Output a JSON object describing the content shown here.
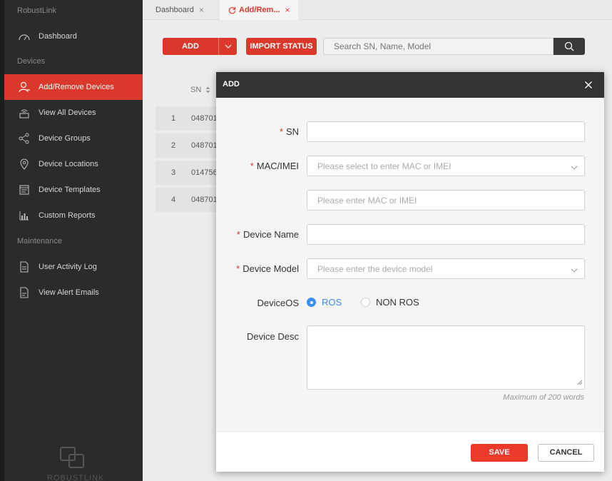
{
  "sidebar": {
    "brand": "RobustLink",
    "sections": {
      "devices": "Devices",
      "maintenance": "Maintenance"
    },
    "items": [
      {
        "label": "Dashboard",
        "icon": "gauge-icon"
      },
      {
        "label": "Add/Remove Devices",
        "icon": "user-add-icon",
        "active": true
      },
      {
        "label": "View All Devices",
        "icon": "router-icon"
      },
      {
        "label": "Device Groups",
        "icon": "share-nodes-icon"
      },
      {
        "label": "Device Locations",
        "icon": "location-pin-icon"
      },
      {
        "label": "Device Templates",
        "icon": "template-icon"
      },
      {
        "label": "Custom Reports",
        "icon": "bar-chart-icon"
      },
      {
        "label": "User Activity Log",
        "icon": "log-document-icon"
      },
      {
        "label": "View Alert Emails",
        "icon": "email-document-icon"
      }
    ],
    "footer_text": "ROBUSTLINK"
  },
  "tabs": [
    {
      "label": "Dashboard",
      "close": "×"
    },
    {
      "label": "Add/Rem...",
      "close": "×",
      "active": true
    }
  ],
  "toolbar": {
    "add_label": "ADD",
    "import_label": "IMPORT STATUS",
    "search_placeholder": "Search SN, Name, Model"
  },
  "table": {
    "sn_header": "SN",
    "rows": [
      {
        "num": "1",
        "sn": "048701"
      },
      {
        "num": "2",
        "sn": "048701"
      },
      {
        "num": "3",
        "sn": "014756"
      },
      {
        "num": "4",
        "sn": "048701"
      }
    ]
  },
  "modal": {
    "title": "ADD",
    "required_mark": "*",
    "fields": {
      "sn_label": "SN",
      "mac_label": "MAC/IMEI",
      "mac_select_placeholder": "Please select to enter MAC or IMEI",
      "mac_input_placeholder": "Please enter MAC or IMEI",
      "name_label": "Device Name",
      "model_label": "Device Model",
      "model_placeholder": "Please enter the device model",
      "os_label": "DeviceOS",
      "os_options": [
        "ROS",
        "NON ROS"
      ],
      "os_selected": "ROS",
      "desc_label": "Device Desc",
      "desc_hint": "Maximum of 200 words"
    },
    "save_label": "SAVE",
    "cancel_label": "CANCEL"
  },
  "colors": {
    "accent": "#d9382b",
    "sidebar_bg": "#2b2b2b",
    "radio_selected": "#3b8ff5"
  }
}
